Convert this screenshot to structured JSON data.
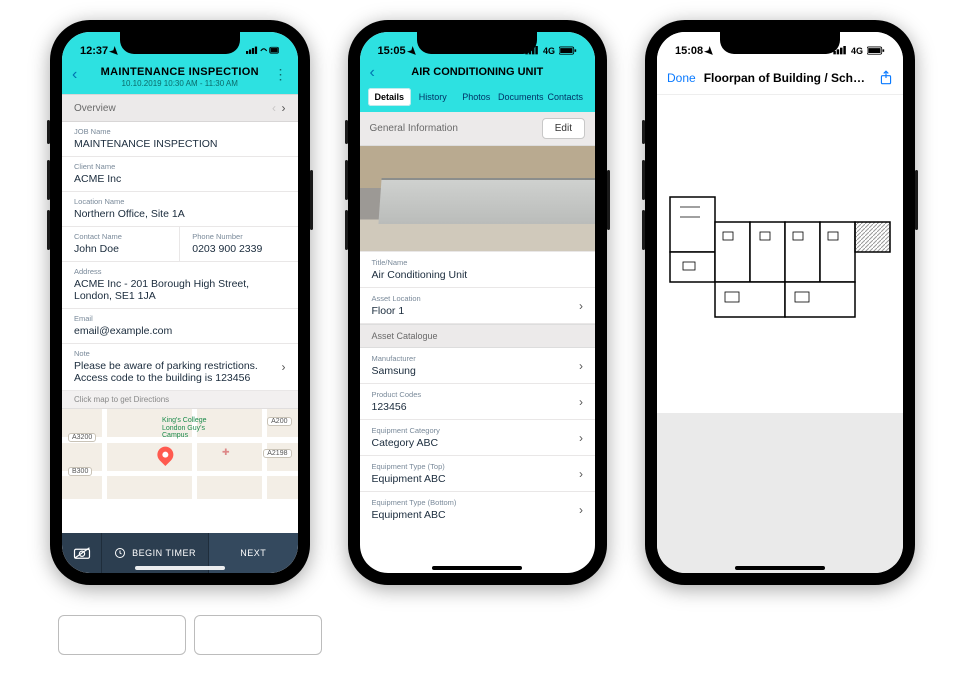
{
  "phone1": {
    "status": {
      "time": "12:37",
      "indicators": "📶 🔋"
    },
    "header": {
      "title": "MAINTENANCE INSPECTION",
      "subtitle": "10.10.2019   10:30 AM - 11:30 AM"
    },
    "overview_label": "Overview",
    "fields": {
      "job_name": {
        "label": "JOB Name",
        "value": "MAINTENANCE INSPECTION"
      },
      "client_name": {
        "label": "Client Name",
        "value": "ACME Inc"
      },
      "location_name": {
        "label": "Location Name",
        "value": "Northern Office, Site 1A"
      },
      "contact_name": {
        "label": "Contact Name",
        "value": "John Doe"
      },
      "phone": {
        "label": "Phone Number",
        "value": "0203 900 2339"
      },
      "address": {
        "label": "Address",
        "value": "ACME Inc - 201 Borough High Street, London, SE1 1JA"
      },
      "email": {
        "label": "Email",
        "value": "email@example.com"
      },
      "note": {
        "label": "Note",
        "value": "Please be aware of parking restrictions. Access code to the building is 123456"
      }
    },
    "map_hint": "Click map to get Directions",
    "road_tags": [
      "A3200",
      "B300",
      "A200",
      "A2198"
    ],
    "map_labels": {
      "college": "King's College London Guy's Campus",
      "hospital": "Guy's Hospital"
    },
    "buttons": {
      "begin_timer": "BEGIN TIMER",
      "next": "NEXT"
    }
  },
  "phone2": {
    "status": {
      "time": "15:05",
      "network": "4G"
    },
    "header": {
      "title": "AIR CONDITIONING UNIT"
    },
    "tabs": [
      "Details",
      "History",
      "Photos",
      "Documents",
      "Contacts"
    ],
    "active_tab_index": 0,
    "general_info": "General Information",
    "edit": "Edit",
    "fields": {
      "title_name": {
        "label": "Title/Name",
        "value": "Air Conditioning Unit"
      },
      "asset_location": {
        "label": "Asset Location",
        "value": "Floor 1"
      }
    },
    "section_label": "Asset Catalogue",
    "catalogue": {
      "manufacturer": {
        "label": "Manufacturer",
        "value": "Samsung"
      },
      "product_codes": {
        "label": "Product Codes",
        "value": "123456"
      },
      "category": {
        "label": "Equipment Category",
        "value": "Category ABC"
      },
      "type_top": {
        "label": "Equipment Type (Top)",
        "value": "Equipment ABC"
      },
      "type_bottom": {
        "label": "Equipment Type (Bottom)",
        "value": "Equipment ABC"
      }
    }
  },
  "phone3": {
    "status": {
      "time": "15:08",
      "network": "4G"
    },
    "done": "Done",
    "title": "Floorpan of Building / Schematic..."
  },
  "icons": {
    "location_arrow": "➤",
    "signal_wifi_batt": "••ll ᯤ ▮",
    "more_vert": "⋮",
    "chevron_left": "‹",
    "chevron_right": "›",
    "clock": "◷",
    "no_camera": "🚫"
  }
}
